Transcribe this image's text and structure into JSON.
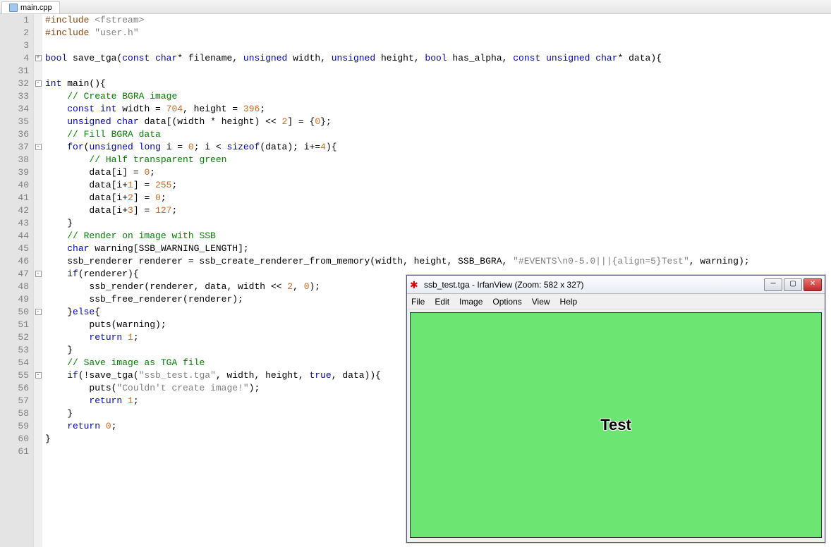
{
  "tab": {
    "label": "main.cpp"
  },
  "code": {
    "lines": [
      {
        "n": 1,
        "fold": "",
        "html": "<span class='c-pp'>#include</span> <span class='c-str'>&lt;fstream&gt;</span>"
      },
      {
        "n": 2,
        "fold": "",
        "html": "<span class='c-pp'>#include</span> <span class='c-str'>\"user.h\"</span>"
      },
      {
        "n": 3,
        "fold": "",
        "html": ""
      },
      {
        "n": 4,
        "fold": "plus",
        "html": "<span class='c-kw'>bool</span> save_tga(<span class='c-kw'>const</span> <span class='c-kw'>char</span>* filename, <span class='c-kw'>unsigned</span> width, <span class='c-kw'>unsigned</span> height, <span class='c-kw'>bool</span> has_alpha, <span class='c-kw'>const</span> <span class='c-kw'>unsigned</span> <span class='c-kw'>char</span>* data){"
      },
      {
        "n": 31,
        "fold": "",
        "html": ""
      },
      {
        "n": 32,
        "fold": "minus",
        "html": "<span class='c-kw'>int</span> main(){"
      },
      {
        "n": 33,
        "fold": "",
        "html": "    <span class='c-com'>// Create BGRA image</span>"
      },
      {
        "n": 34,
        "fold": "",
        "html": "    <span class='c-kw'>const</span> <span class='c-kw'>int</span> width = <span class='c-num'>704</span>, height = <span class='c-num'>396</span>;"
      },
      {
        "n": 35,
        "fold": "",
        "html": "    <span class='c-kw'>unsigned</span> <span class='c-kw'>char</span> data[(width * height) &lt;&lt; <span class='c-num'>2</span>] = {<span class='c-num'>0</span>};"
      },
      {
        "n": 36,
        "fold": "",
        "html": "    <span class='c-com'>// Fill BGRA data</span>"
      },
      {
        "n": 37,
        "fold": "minus",
        "html": "    <span class='c-kw'>for</span>(<span class='c-kw'>unsigned</span> <span class='c-kw'>long</span> i = <span class='c-num'>0</span>; i &lt; <span class='c-kw'>sizeof</span>(data); i+=<span class='c-num'>4</span>){"
      },
      {
        "n": 38,
        "fold": "",
        "html": "        <span class='c-com'>// Half transparent green</span>"
      },
      {
        "n": 39,
        "fold": "",
        "html": "        data[i] = <span class='c-num'>0</span>;"
      },
      {
        "n": 40,
        "fold": "",
        "html": "        data[i+<span class='c-num'>1</span>] = <span class='c-num'>255</span>;"
      },
      {
        "n": 41,
        "fold": "",
        "html": "        data[i+<span class='c-num'>2</span>] = <span class='c-num'>0</span>;"
      },
      {
        "n": 42,
        "fold": "",
        "html": "        data[i+<span class='c-num'>3</span>] = <span class='c-num'>127</span>;"
      },
      {
        "n": 43,
        "fold": "",
        "html": "    }"
      },
      {
        "n": 44,
        "fold": "",
        "html": "    <span class='c-com'>// Render on image with SSB</span>"
      },
      {
        "n": 45,
        "fold": "",
        "html": "    <span class='c-kw'>char</span> warning[SSB_WARNING_LENGTH];"
      },
      {
        "n": 46,
        "fold": "",
        "html": "    ssb_renderer renderer = ssb_create_renderer_from_memory(width, height, SSB_BGRA, <span class='c-str'>\"#EVENTS\\n0-5.0|||{align=5}Test\"</span>, warning);"
      },
      {
        "n": 47,
        "fold": "minus",
        "html": "    <span class='c-kw'>if</span>(renderer){"
      },
      {
        "n": 48,
        "fold": "",
        "html": "        ssb_render(renderer, data, width &lt;&lt; <span class='c-num'>2</span>, <span class='c-num'>0</span>);"
      },
      {
        "n": 49,
        "fold": "",
        "html": "        ssb_free_renderer(renderer);"
      },
      {
        "n": 50,
        "fold": "minus",
        "html": "    }<span class='c-kw'>else</span>{"
      },
      {
        "n": 51,
        "fold": "",
        "html": "        puts(warning);"
      },
      {
        "n": 52,
        "fold": "",
        "html": "        <span class='c-kw'>return</span> <span class='c-num'>1</span>;"
      },
      {
        "n": 53,
        "fold": "",
        "html": "    }"
      },
      {
        "n": 54,
        "fold": "",
        "html": "    <span class='c-com'>// Save image as TGA file</span>"
      },
      {
        "n": 55,
        "fold": "minus",
        "html": "    <span class='c-kw'>if</span>(!save_tga(<span class='c-str'>\"ssb_test.tga\"</span>, width, height, <span class='c-kw'>true</span>, data)){"
      },
      {
        "n": 56,
        "fold": "",
        "html": "        puts(<span class='c-str'>\"Couldn't create image!\"</span>);"
      },
      {
        "n": 57,
        "fold": "",
        "html": "        <span class='c-kw'>return</span> <span class='c-num'>1</span>;"
      },
      {
        "n": 58,
        "fold": "",
        "html": "    }"
      },
      {
        "n": 59,
        "fold": "",
        "html": "    <span class='c-kw'>return</span> <span class='c-num'>0</span>;"
      },
      {
        "n": 60,
        "fold": "",
        "html": "}"
      },
      {
        "n": 61,
        "fold": "",
        "html": ""
      }
    ]
  },
  "irfanview": {
    "title": "ssb_test.tga - IrfanView (Zoom: 582 x 327)",
    "menu": [
      "File",
      "Edit",
      "Image",
      "Options",
      "View",
      "Help"
    ],
    "canvas_text": "Test",
    "min_glyph": "─",
    "max_glyph": "▢",
    "close_glyph": "✕"
  }
}
